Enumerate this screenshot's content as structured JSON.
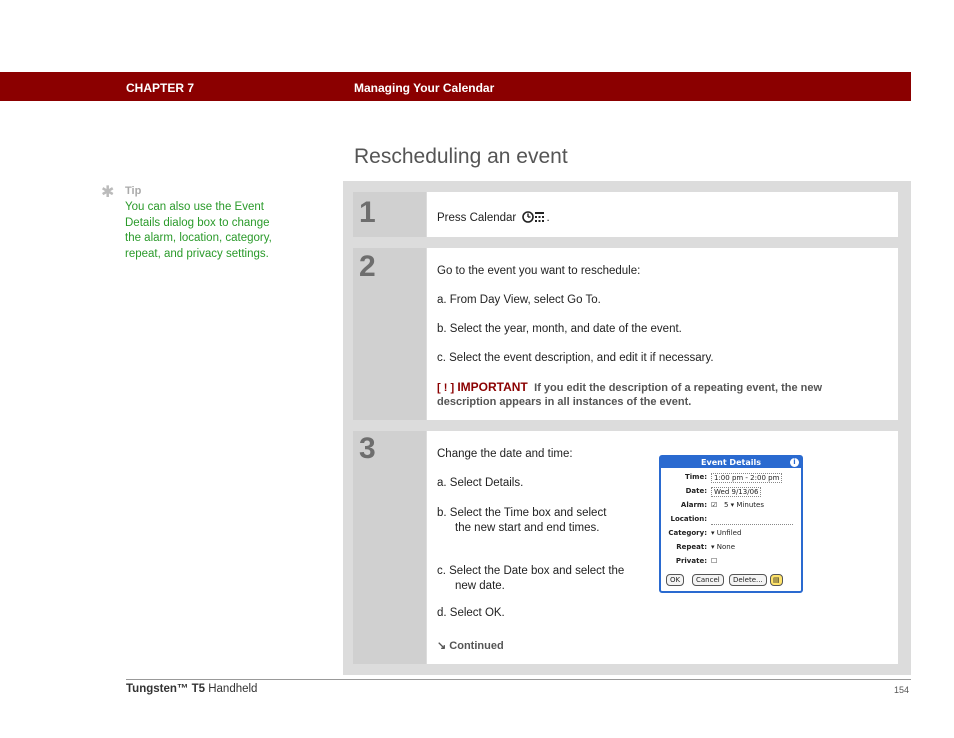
{
  "header": {
    "chapter": "CHAPTER 7",
    "title": "Managing Your Calendar",
    "bar_color": "#8b0000"
  },
  "page_title": "Rescheduling an event",
  "tip": {
    "icon": "asterisk-icon",
    "label": "Tip",
    "text": "You can also use the Event Details dialog box to change the alarm, location, category, repeat, and privacy settings."
  },
  "steps": [
    {
      "number": "1",
      "text": "Press Calendar",
      "icon": "calendar-button-icon"
    },
    {
      "number": "2",
      "intro": "Go to the event you want to reschedule:",
      "items": [
        "a.  From Day View, select Go To.",
        "b.  Select the year, month, and date of the event.",
        "c.  Select the event description, and edit it if necessary."
      ],
      "important": {
        "bracket": "[ ! ]",
        "label": "IMPORTANT",
        "text": "If you edit the description of a repeating event, the new description appears in all instances of the event."
      }
    },
    {
      "number": "3",
      "intro": "Change the date and time:",
      "items": [
        "a.  Select Details.",
        "b.  Select the Time box and select the new start and end times.",
        "c.  Select the Date box and select the new date.",
        "d.  Select OK."
      ],
      "continued": "Continued"
    }
  ],
  "dialog": {
    "title": "Event Details",
    "time_label": "Time:",
    "time_value": "1:00 pm - 2:00 pm",
    "date_label": "Date:",
    "date_value": "Wed 9/13/06",
    "alarm_label": "Alarm:",
    "alarm_value": "5",
    "alarm_unit": "Minutes",
    "location_label": "Location:",
    "category_label": "Category:",
    "category_value": "Unfiled",
    "repeat_label": "Repeat:",
    "repeat_value": "None",
    "private_label": "Private:",
    "buttons": [
      "OK",
      "Cancel",
      "Delete..."
    ]
  },
  "footer": {
    "product_bold": "Tungsten™ T5",
    "product_rest": "Handheld",
    "page_number": "154"
  }
}
